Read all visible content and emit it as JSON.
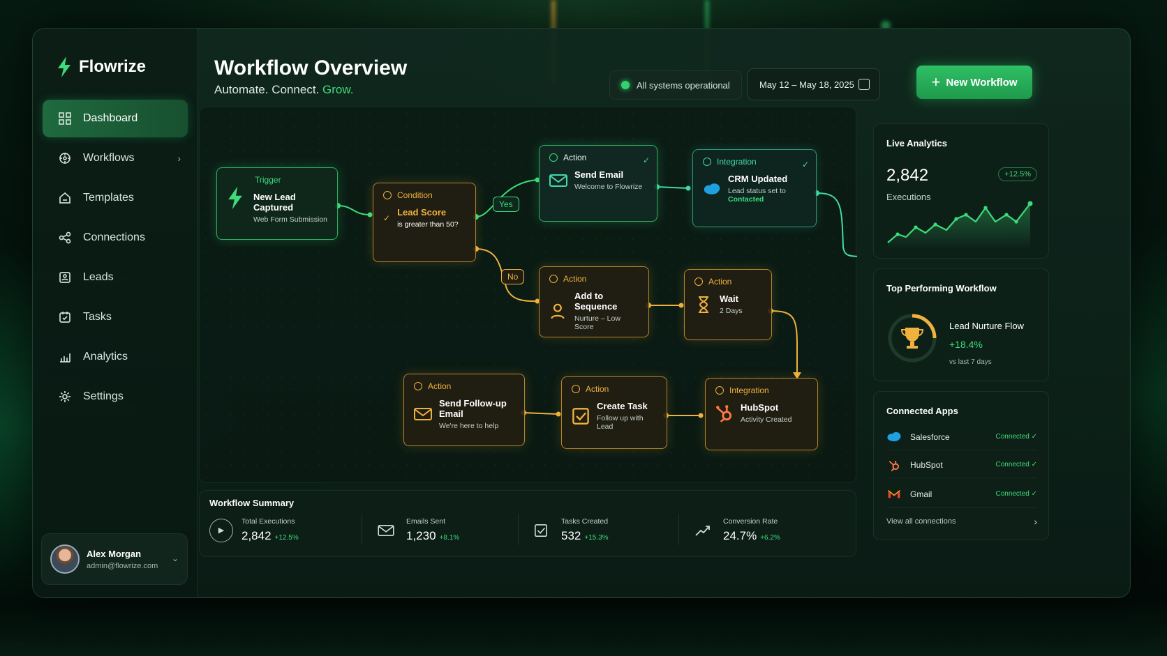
{
  "app": {
    "name": "Flowrize"
  },
  "sidebar": {
    "items": [
      {
        "label": "Dashboard",
        "icon": "grid-icon"
      },
      {
        "label": "Workflows",
        "icon": "workflow-icon"
      },
      {
        "label": "Templates",
        "icon": "template-icon"
      },
      {
        "label": "Connections",
        "icon": "share-icon"
      },
      {
        "label": "Leads",
        "icon": "leads-icon"
      },
      {
        "label": "Tasks",
        "icon": "tasks-icon"
      },
      {
        "label": "Analytics",
        "icon": "analytics-icon"
      },
      {
        "label": "Settings",
        "icon": "gear-icon"
      }
    ],
    "user": {
      "name": "Alex Morgan",
      "email": "admin@flowrize.com"
    }
  },
  "header": {
    "title": "Workflow Overview",
    "subtitle_a": "Automate.",
    "subtitle_b": "Connect.",
    "subtitle_c": "Grow.",
    "status": "All systems operational",
    "date_range": "May 12 – May 18, 2025",
    "new_button": "New Workflow"
  },
  "workflow": {
    "trigger": {
      "type": "Trigger",
      "title": "New Lead Captured",
      "sub": "Web Form Submission"
    },
    "condition": {
      "type": "Condition",
      "title": "Lead Score",
      "sub": "is greater than 50?"
    },
    "yes": "Yes",
    "no": "No",
    "send_email": {
      "type": "Action",
      "title": "Send Email",
      "sub": "Welcome to Flowrize"
    },
    "crm": {
      "type": "Integration",
      "title": "CRM Updated",
      "sub": "Lead status set to",
      "sub2": "Contacted"
    },
    "sequence": {
      "type": "Action",
      "title": "Add to Sequence",
      "sub": "Nurture – Low Score"
    },
    "wait": {
      "type": "Action",
      "title": "Wait",
      "sub": "2 Days"
    },
    "followup": {
      "type": "Action",
      "title": "Send Follow-up Email",
      "sub": "We're here to help"
    },
    "task": {
      "type": "Action",
      "title": "Create Task",
      "sub": "Follow up with Lead"
    },
    "hubspot": {
      "type": "Integration",
      "title": "HubSpot",
      "sub": "Activity Created"
    }
  },
  "summary": {
    "title": "Workflow Summary",
    "stats": [
      {
        "label": "Total Executions",
        "value": "2,842",
        "delta": "+12.5%"
      },
      {
        "label": "Emails Sent",
        "value": "1,230",
        "delta": "+8.1%"
      },
      {
        "label": "Tasks Created",
        "value": "532",
        "delta": "+15.3%"
      },
      {
        "label": "Conversion Rate",
        "value": "24.7%",
        "delta": "+6.2%"
      }
    ]
  },
  "analytics": {
    "title": "Live Analytics",
    "value": "2,842",
    "label": "Executions",
    "change": "+12.5%"
  },
  "top": {
    "title": "Top Performing Workflow",
    "name": "Lead Nurture Flow",
    "change": "+18.4%",
    "period": "vs last 7 days"
  },
  "apps": {
    "title": "Connected Apps",
    "items": [
      {
        "name": "Salesforce",
        "status": "Connected ✓"
      },
      {
        "name": "HubSpot",
        "status": "Connected ✓"
      },
      {
        "name": "Gmail",
        "status": "Connected ✓"
      }
    ],
    "view_all": "View all connections"
  },
  "colors": {
    "accent": "#3ddc7a",
    "orange": "#f0b23e",
    "teal": "#43d8aa"
  }
}
